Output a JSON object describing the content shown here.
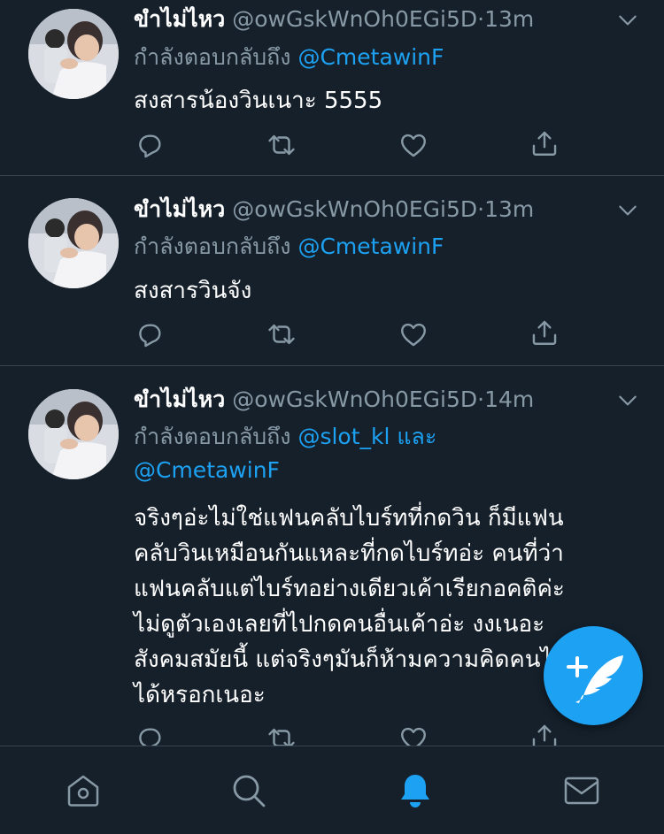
{
  "colors": {
    "background": "#15202b",
    "accent": "#1da1f2",
    "secondary_text": "#8899a6",
    "divider": "#38444d"
  },
  "tweets": [
    {
      "name": "ขำไม่ไหว",
      "handle": "@owGskWnOh0EGi5D",
      "sep": "·",
      "time": "13m",
      "reply_prefix": "กำลังตอบกลับถึง",
      "mention1": "@CmetawinF",
      "mention_joiner": "",
      "mention2": "",
      "text": "สงสารน้องวินเนาะ 5555"
    },
    {
      "name": "ขำไม่ไหว",
      "handle": "@owGskWnOh0EGi5D",
      "sep": "·",
      "time": "13m",
      "reply_prefix": "กำลังตอบกลับถึง",
      "mention1": "@CmetawinF",
      "mention_joiner": "",
      "mention2": "",
      "text": "สงสารวินจัง"
    },
    {
      "name": "ขำไม่ไหว",
      "handle": "@owGskWnOh0EGi5D",
      "sep": "·",
      "time": "14m",
      "reply_prefix": "กำลังตอบกลับถึง",
      "mention1": "@slot_kl",
      "mention_joiner": "และ",
      "mention2": "@CmetawinF",
      "text_lines": [
        "จริงๆอ่ะไม่ใช่แฟนคลับไบร์ทที่กดวิน ก็มีแฟน",
        "คลับวินเหมือนกันแหละที่กดไบร์ทอ่ะ คนที่ว่า",
        "แฟนคลับแต่ไบร์ทอย่างเดียวเค้าเรียกอคติค่ะ",
        "ไม่ดูตัวเองเลยที่ไปกดคนอื่นเค้าอ่ะ งงเนอะ",
        "สังคมสมัยนี้ แต่จริงๆมันก็ห้ามความคิดคนไม่",
        "ได้หรอกเนอะ"
      ]
    }
  ],
  "actions": {
    "reply": "reply-icon",
    "retweet": "retweet-icon",
    "like": "heart-icon",
    "share": "share-icon"
  },
  "bottom_nav": [
    {
      "icon": "home-icon",
      "active": false
    },
    {
      "icon": "search-icon",
      "active": false
    },
    {
      "icon": "bell-icon",
      "active": true
    },
    {
      "icon": "envelope-icon",
      "active": false
    }
  ],
  "fab": {
    "icon": "compose-tweet-icon"
  }
}
